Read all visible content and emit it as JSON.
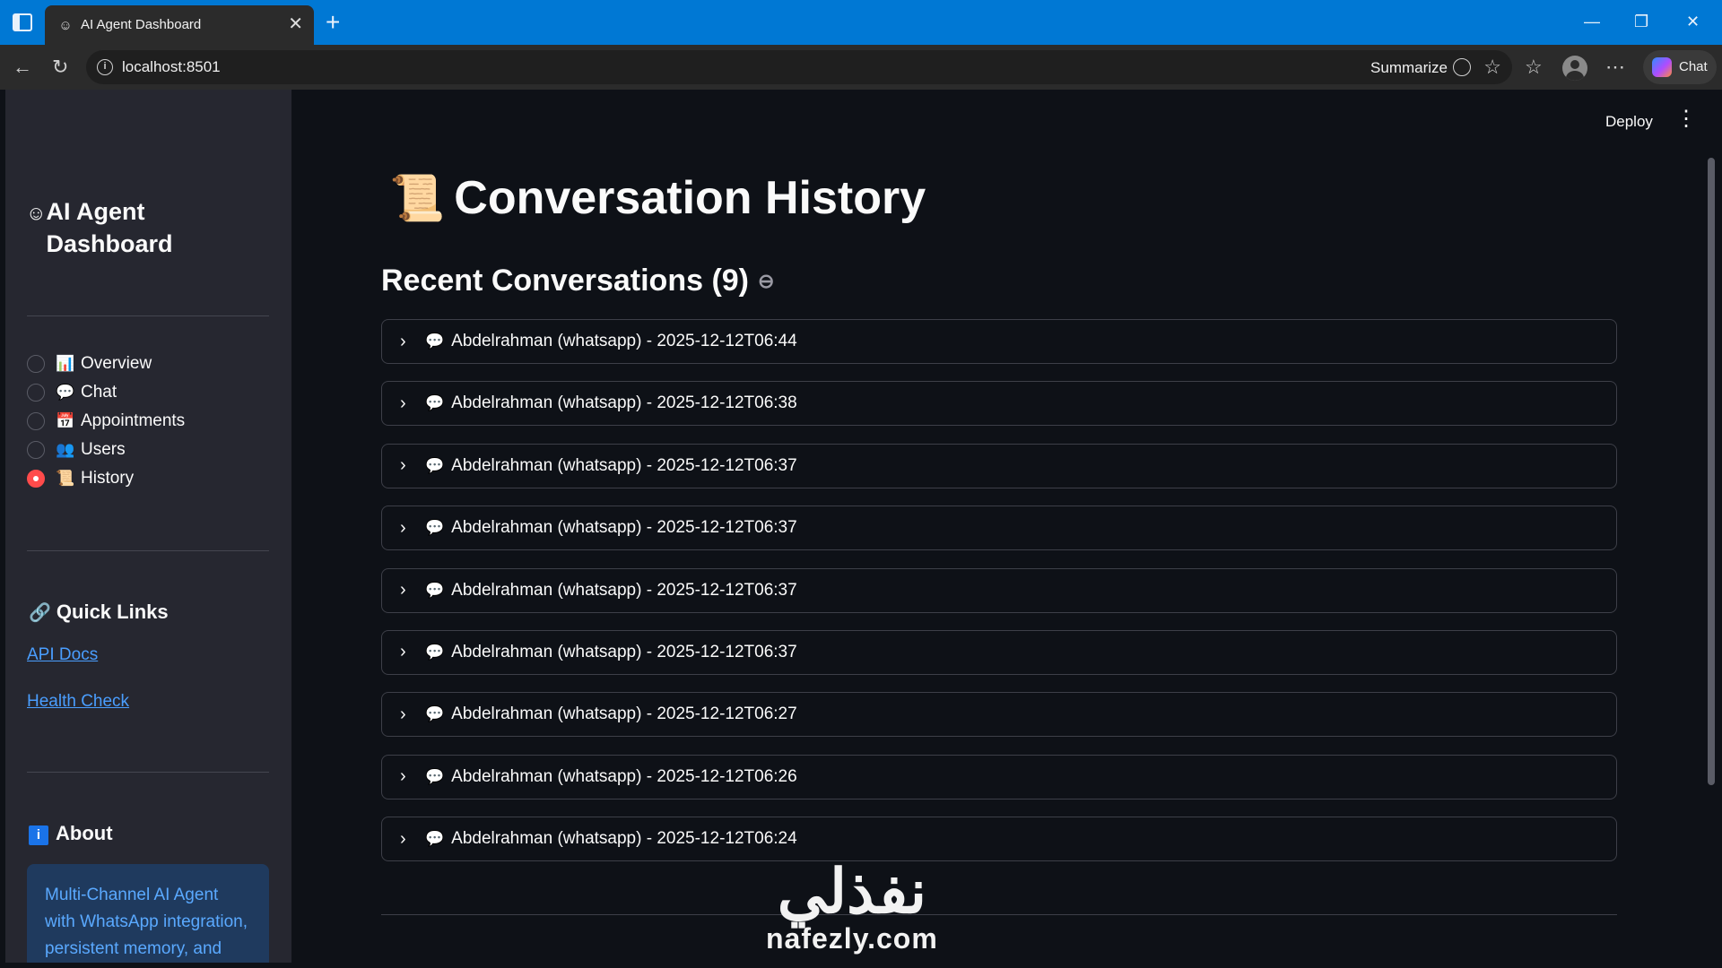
{
  "browser": {
    "tab_title": "AI Agent Dashboard",
    "url": "localhost:8501",
    "summarize_label": "Summarize",
    "copilot_label": "Chat",
    "icons": [
      "sidebar-toggle-icon",
      "close-icon",
      "plus-icon",
      "back-icon",
      "reload-icon",
      "info-icon",
      "star-icon",
      "favorites-icon",
      "profile-icon",
      "more-icon"
    ]
  },
  "sidebar": {
    "title_icon": "☺",
    "title": "AI Agent Dashboard",
    "nav": [
      {
        "icon": "📊",
        "label": "Overview",
        "selected": false
      },
      {
        "icon": "💬",
        "label": "Chat",
        "selected": false
      },
      {
        "icon": "📅",
        "label": "Appointments",
        "selected": false
      },
      {
        "icon": "👥",
        "label": "Users",
        "selected": false
      },
      {
        "icon": "📜",
        "label": "History",
        "selected": true
      }
    ],
    "quick_links": {
      "icon": "🔗",
      "title": "Quick Links",
      "links": [
        "API Docs",
        "Health Check"
      ]
    },
    "about": {
      "icon": "i",
      "title": "About",
      "text": "Multi-Channel AI Agent with WhatsApp integration, persistent memory, and"
    }
  },
  "header": {
    "deploy_label": "Deploy",
    "menu_icon": "⋮"
  },
  "main": {
    "title_icon": "📜",
    "title": "Conversation History",
    "subheader": "Recent Conversations (9)",
    "conversations": [
      "Abdelrahman (whatsapp) - 2025-12-12T06:44",
      "Abdelrahman (whatsapp) - 2025-12-12T06:38",
      "Abdelrahman (whatsapp) - 2025-12-12T06:37",
      "Abdelrahman (whatsapp) - 2025-12-12T06:37",
      "Abdelrahman (whatsapp) - 2025-12-12T06:37",
      "Abdelrahman (whatsapp) - 2025-12-12T06:37",
      "Abdelrahman (whatsapp) - 2025-12-12T06:27",
      "Abdelrahman (whatsapp) - 2025-12-12T06:26",
      "Abdelrahman (whatsapp) - 2025-12-12T06:24"
    ]
  },
  "watermark": {
    "arabic": "نفذلي",
    "latin": "nafezly.com"
  },
  "colors": {
    "browser_accent": "#0078d4",
    "sidebar_bg": "#262730",
    "main_bg": "#0e1117",
    "radio_selected": "#ff4b4b",
    "link": "#4a9eff",
    "about_bg": "#1f3a5e"
  }
}
